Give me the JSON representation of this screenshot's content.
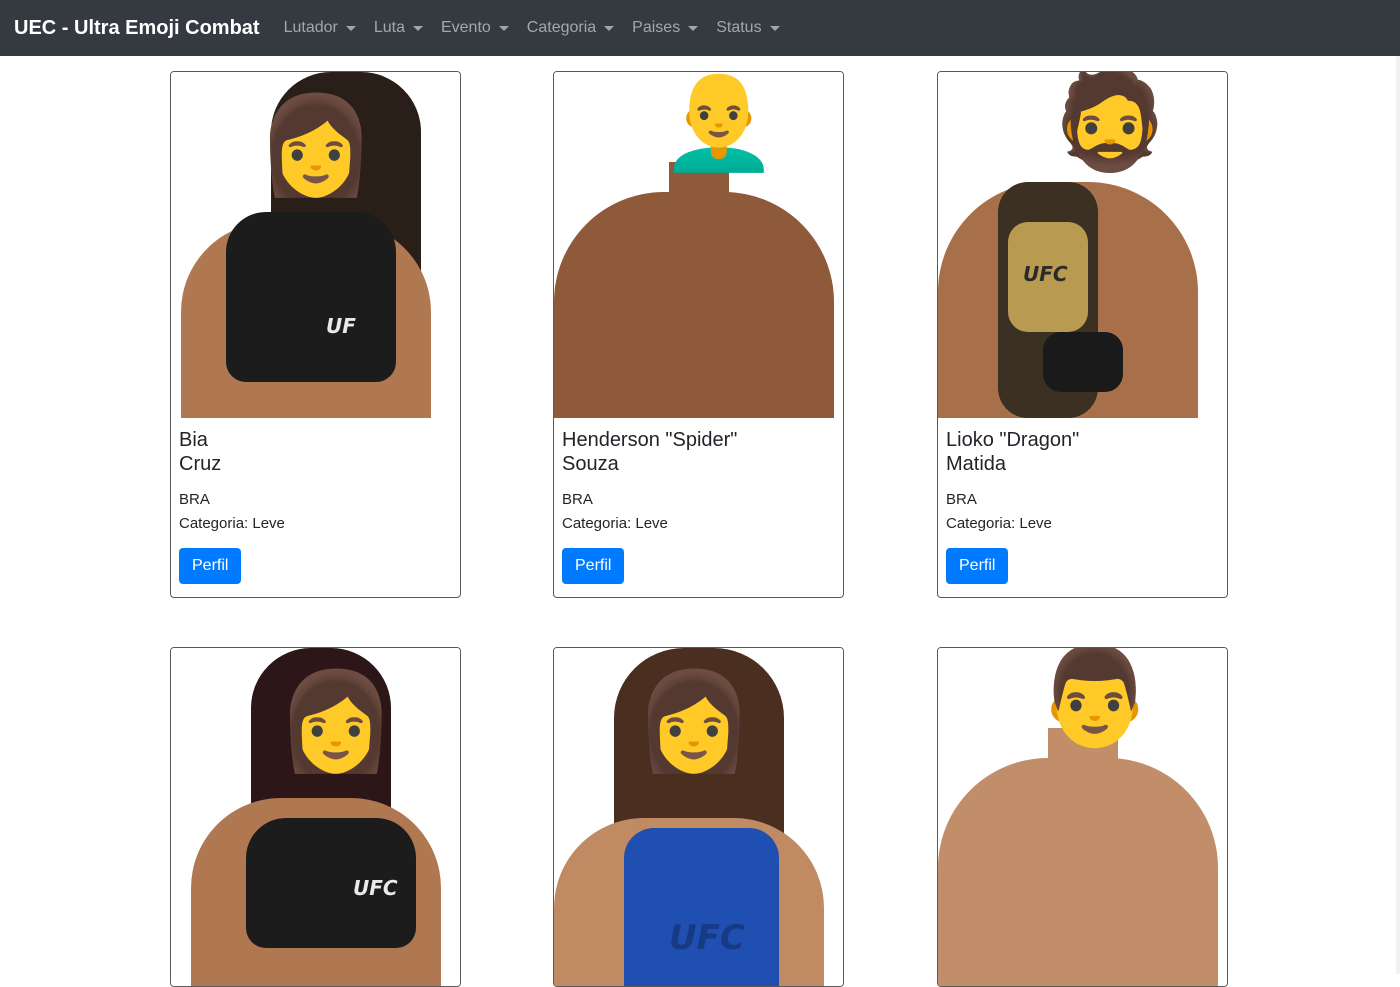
{
  "navbar": {
    "brand": "UEC - Ultra Emoji Combat",
    "items": [
      {
        "label": "Lutador"
      },
      {
        "label": "Luta"
      },
      {
        "label": "Evento"
      },
      {
        "label": "Categoria"
      },
      {
        "label": "Paises"
      },
      {
        "label": "Status"
      }
    ]
  },
  "fighters": [
    {
      "first": "Bia",
      "last": "Cruz",
      "country": "BRA",
      "category": "Categoria: Leve",
      "button": "Perfil",
      "emoji": "👩",
      "logo": "UF"
    },
    {
      "first": "Henderson \"Spider\"",
      "last": "Souza",
      "country": "BRA",
      "category": "Categoria: Leve",
      "button": "Perfil",
      "emoji": "👨‍🦲"
    },
    {
      "first": "Lioko \"Dragon\"",
      "last": "Matida",
      "country": "BRA",
      "category": "Categoria: Leve",
      "button": "Perfil",
      "emoji": "🧔",
      "logo": "UFC"
    },
    {
      "emoji": "👩",
      "logo": "UFC"
    },
    {
      "emoji": "👩",
      "logo": "UFC"
    },
    {
      "emoji": "👨"
    }
  ],
  "colors": {
    "navbar_bg": "#343a40",
    "button_bg": "#007bff",
    "skin_tone": "#b07850"
  }
}
